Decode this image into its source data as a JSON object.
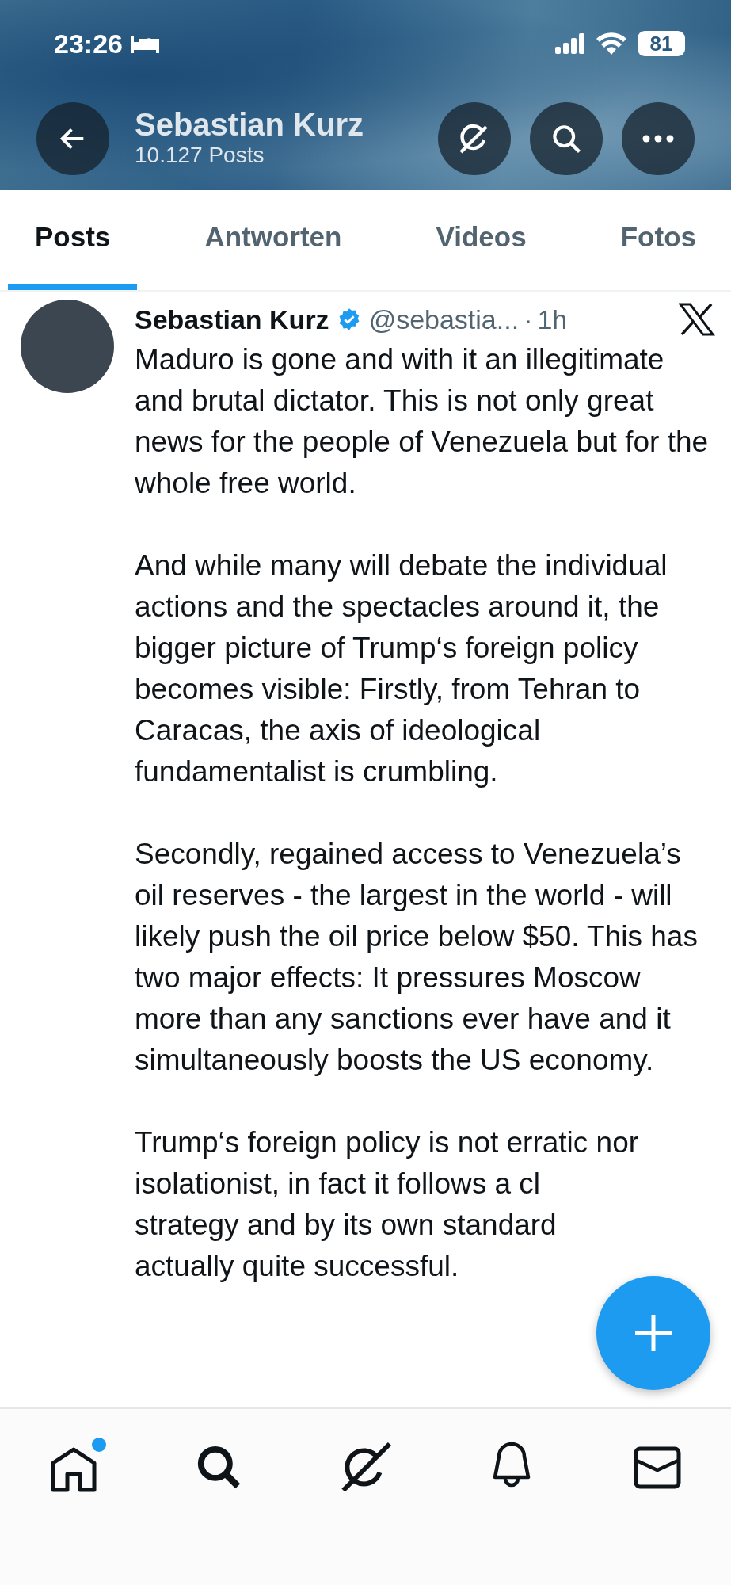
{
  "status_bar": {
    "time": "23:26",
    "battery": "81"
  },
  "header": {
    "title": "Sebastian Kurz",
    "subtitle": "10.127 Posts"
  },
  "tabs": [
    {
      "label": "Posts",
      "selected": true
    },
    {
      "label": "Antworten",
      "selected": false
    },
    {
      "label": "Videos",
      "selected": false
    },
    {
      "label": "Fotos",
      "selected": false
    }
  ],
  "post": {
    "author": "Sebastian Kurz",
    "verified": true,
    "handle": "@sebastia...",
    "separator": "·",
    "time": "1h",
    "paragraphs": [
      {
        "kind": "text",
        "text": "Maduro is gone and with it an illegitimate and brutal dictator. This is not only great news for the people of Venezuela but for the whole free world."
      },
      {
        "kind": "text",
        "text": "And while many will debate the individual actions and the spectacles around it, the bigger picture of Trump‘s foreign policy becomes visible: Firstly, from Tehran to Caracas, the axis of ideological fundamentalist is crumbling."
      },
      {
        "kind": "text",
        "text": "Secondly, regained access to Venezuela’s oil reserves - the largest in the world - will likely push the oil price below $50. This has two major effects: It pressures Moscow more than any sanctions ever have and it simultaneously boosts the US economy."
      },
      {
        "kind": "lines",
        "lines": [
          "Trump‘s foreign policy is not erratic nor",
          "isolationist, in fact it follows a cl",
          "strategy and by its own standard",
          "actually quite successful."
        ]
      }
    ]
  },
  "bottom_nav": [
    {
      "kind": "home",
      "badge": true
    },
    {
      "kind": "search",
      "badge": false
    },
    {
      "kind": "grok",
      "badge": false
    },
    {
      "kind": "notifications",
      "badge": false
    },
    {
      "kind": "messages",
      "badge": false
    }
  ]
}
